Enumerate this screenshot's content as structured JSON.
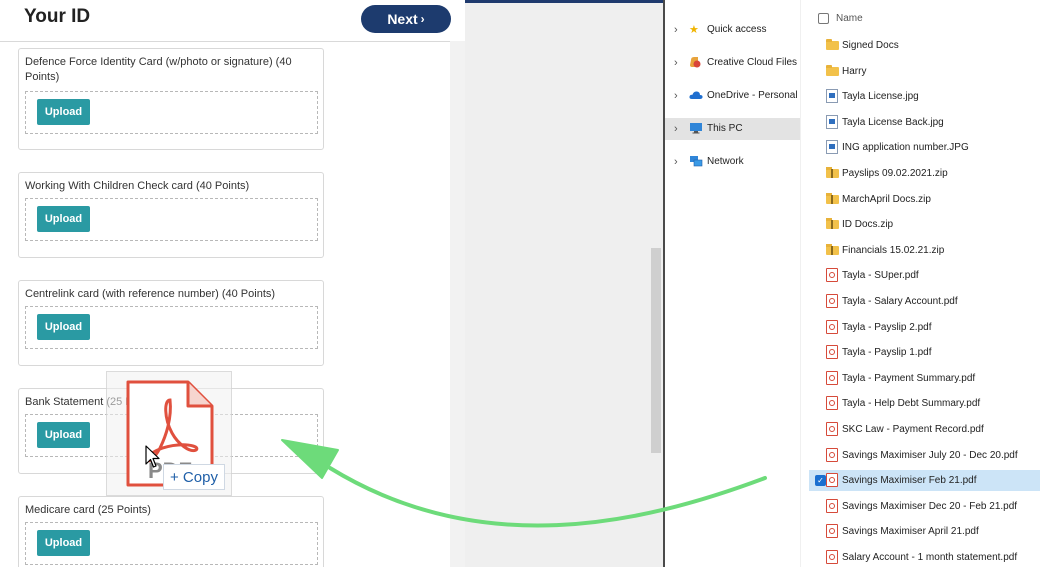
{
  "web_page": {
    "title": "Your ID",
    "next_button": "Next",
    "cards": [
      {
        "title": "Defence Force Identity Card (w/photo or signature) (40 Points)",
        "upload_label": "Upload"
      },
      {
        "title": "Working With Children Check card (40 Points)",
        "upload_label": "Upload"
      },
      {
        "title": "Centrelink card (with reference number) (40 Points)",
        "upload_label": "Upload"
      },
      {
        "title": "Bank Statement (25 Points)",
        "upload_label": "Upload"
      },
      {
        "title": "Medicare card (25 Points)",
        "upload_label": "Upload"
      }
    ]
  },
  "drag": {
    "copy_label": "+ Copy",
    "icon": "pdf-file-icon",
    "arrow_color": "#6ddb7a"
  },
  "explorer": {
    "nav": [
      {
        "label": "Quick access",
        "icon": "star-icon",
        "selected": false
      },
      {
        "label": "Creative Cloud Files",
        "icon": "creative-cloud-icon",
        "selected": false
      },
      {
        "label": "OneDrive - Personal",
        "icon": "cloud-icon",
        "selected": false
      },
      {
        "label": "This PC",
        "icon": "computer-icon",
        "selected": true
      },
      {
        "label": "Network",
        "icon": "network-icon",
        "selected": false
      }
    ],
    "column_header": "Name",
    "files": [
      {
        "name": "Signed Docs",
        "type": "folder"
      },
      {
        "name": "Harry",
        "type": "folder"
      },
      {
        "name": "Tayla License.jpg",
        "type": "image"
      },
      {
        "name": "Tayla License Back.jpg",
        "type": "image"
      },
      {
        "name": "ING application number.JPG",
        "type": "image"
      },
      {
        "name": "Payslips 09.02.2021.zip",
        "type": "zip"
      },
      {
        "name": "MarchApril Docs.zip",
        "type": "zip"
      },
      {
        "name": "ID Docs.zip",
        "type": "zip"
      },
      {
        "name": "Financials 15.02.21.zip",
        "type": "zip"
      },
      {
        "name": "Tayla - SUper.pdf",
        "type": "pdf"
      },
      {
        "name": "Tayla - Salary Account.pdf",
        "type": "pdf"
      },
      {
        "name": "Tayla - Payslip 2.pdf",
        "type": "pdf"
      },
      {
        "name": "Tayla - Payslip 1.pdf",
        "type": "pdf"
      },
      {
        "name": "Tayla - Payment Summary.pdf",
        "type": "pdf"
      },
      {
        "name": "Tayla - Help Debt Summary.pdf",
        "type": "pdf"
      },
      {
        "name": "SKC Law - Payment Record.pdf",
        "type": "pdf"
      },
      {
        "name": "Savings Maximiser July 20 - Dec 20.pdf",
        "type": "pdf"
      },
      {
        "name": "Savings Maximiser Feb 21.pdf",
        "type": "pdf",
        "selected": true
      },
      {
        "name": "Savings Maximiser Dec 20 - Feb 21.pdf",
        "type": "pdf"
      },
      {
        "name": "Savings Maximiser April 21.pdf",
        "type": "pdf"
      },
      {
        "name": "Salary Account - 1 month statement.pdf",
        "type": "pdf"
      }
    ]
  },
  "colors": {
    "primary_navy": "#1d3b6e",
    "upload_teal": "#2a9aa3",
    "selection_blue": "#cce4f7",
    "pdf_red": "#e0503e"
  }
}
